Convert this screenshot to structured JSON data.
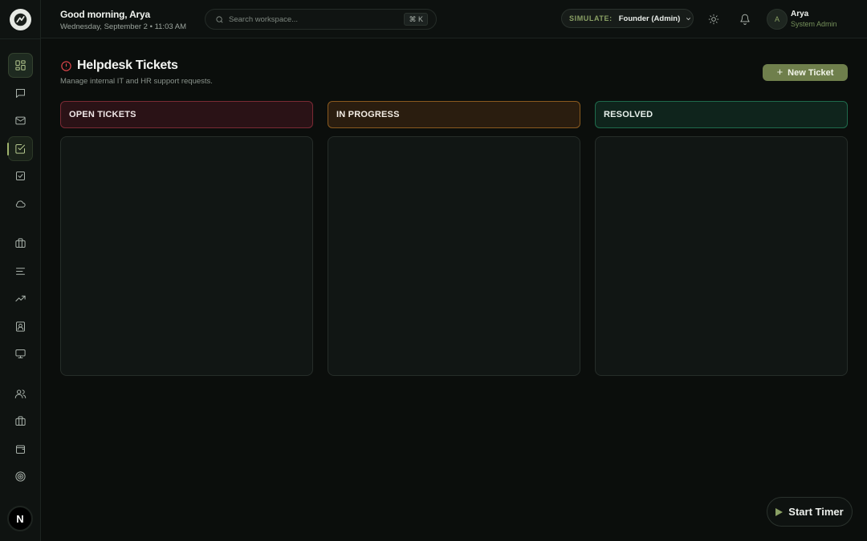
{
  "header": {
    "greeting": "Good morning, Arya",
    "datetime": "Wednesday, September 2 • 11:03 AM",
    "search_placeholder": "Search workspace...",
    "search_shortcut": "⌘ K",
    "simulate_label": "SIMULATE:",
    "simulate_value": "Founder (Admin)",
    "user_initial": "A",
    "user_name": "Arya",
    "user_role": "System Admin"
  },
  "sidebar": {
    "items": [
      {
        "icon": "dashboard-icon"
      },
      {
        "icon": "chat-icon"
      },
      {
        "icon": "mail-icon"
      },
      {
        "icon": "helpdesk-icon"
      },
      {
        "icon": "tasks-icon"
      },
      {
        "icon": "cloud-icon"
      },
      {
        "icon": "briefcase-icon"
      },
      {
        "icon": "list-icon"
      },
      {
        "icon": "trending-icon"
      },
      {
        "icon": "contact-icon"
      },
      {
        "icon": "monitor-icon"
      },
      {
        "icon": "users-icon"
      },
      {
        "icon": "briefcase-icon"
      },
      {
        "icon": "wallet-icon"
      },
      {
        "icon": "target-icon"
      }
    ],
    "bottom_initial": "N"
  },
  "main": {
    "title": "Helpdesk Tickets",
    "subtitle": "Manage internal IT and HR support requests.",
    "new_button": "New Ticket",
    "columns": [
      {
        "label": "OPEN TICKETS",
        "color": "#e5484d"
      },
      {
        "label": "IN PROGRESS",
        "color": "#d4892a"
      },
      {
        "label": "RESOLVED",
        "color": "#2fa872"
      }
    ]
  },
  "timer": {
    "label": "Start Timer"
  }
}
